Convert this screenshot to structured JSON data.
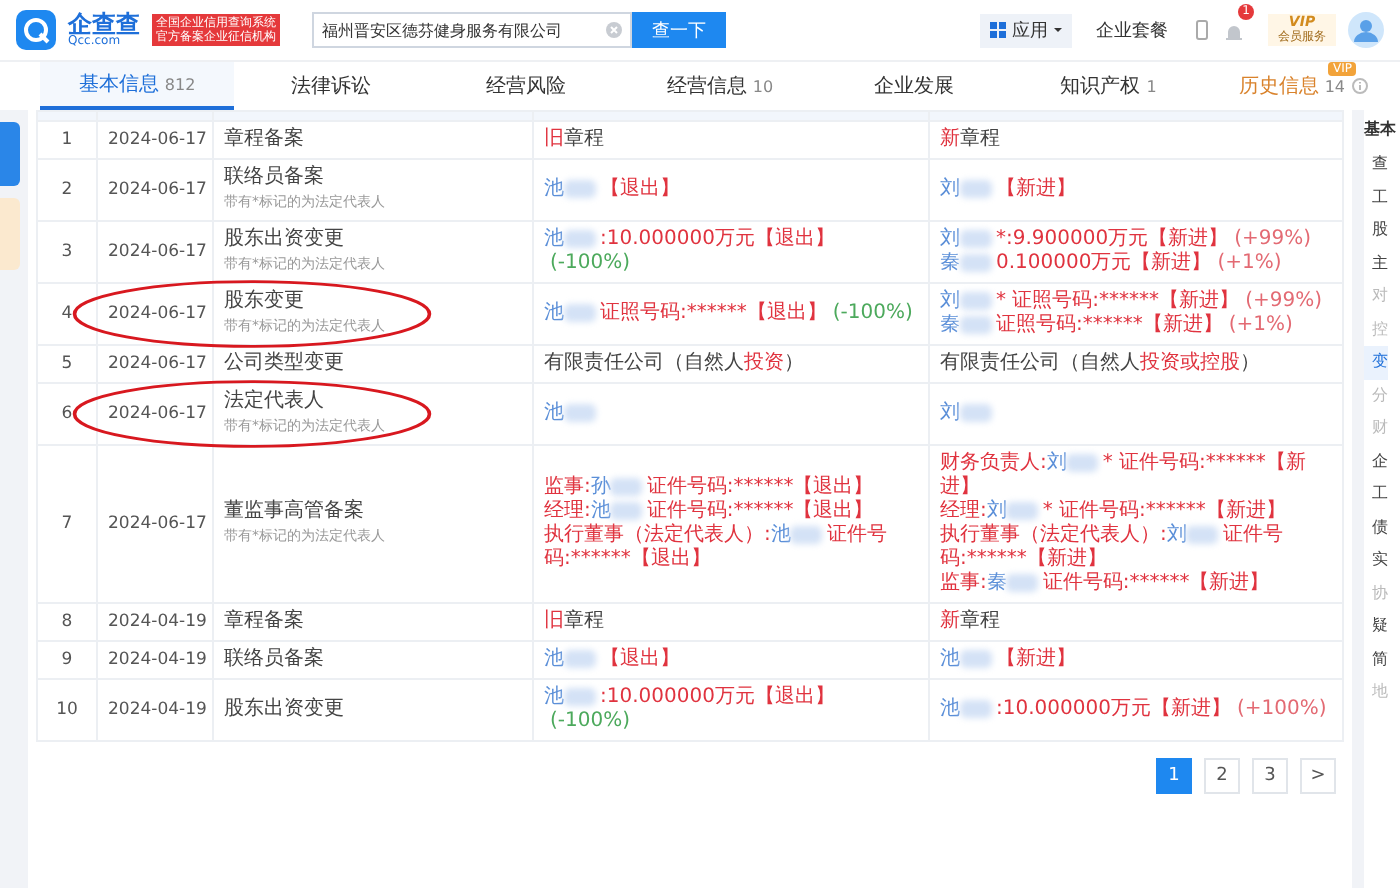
{
  "header": {
    "logo": {
      "name": "企查查",
      "domain": "Qcc.com",
      "slogan": [
        "全国企业信用查询系统",
        "官方备案企业征信机构"
      ]
    },
    "search": {
      "value": "福州晋安区德芬健身服务有限公司",
      "button": "查一下"
    },
    "apps": "应用",
    "plans": "企业套餐",
    "notifications": "1",
    "vip": {
      "badge": "VIP",
      "label": "会员服务"
    }
  },
  "tabs": [
    {
      "label": "基本信息",
      "count": "812",
      "selected": true,
      "kind": "normal"
    },
    {
      "label": "法律诉讼",
      "selected": false,
      "kind": "normal"
    },
    {
      "label": "经营风险",
      "selected": false,
      "kind": "normal"
    },
    {
      "label": "经营信息",
      "count": "10",
      "selected": false,
      "kind": "normal"
    },
    {
      "label": "企业发展",
      "selected": false,
      "kind": "normal"
    },
    {
      "label": "知识产权",
      "count": "1",
      "selected": false,
      "kind": "normal"
    },
    {
      "label": "历史信息",
      "count": "14",
      "selected": false,
      "kind": "premium",
      "badge": "VIP"
    }
  ],
  "table": {
    "rows": [
      {
        "index": "1",
        "date": "2024-06-17",
        "type": "章程备案",
        "circled": false,
        "old": [
          [
            {
              "kind": "red",
              "text": "旧"
            },
            {
              "kind": "plain",
              "text": "章程"
            }
          ]
        ],
        "new": [
          [
            {
              "kind": "red",
              "text": "新"
            },
            {
              "kind": "plain",
              "text": "章程"
            }
          ]
        ]
      },
      {
        "index": "2",
        "date": "2024-06-17",
        "type": "联络员备案",
        "note": "带有*标记的为法定代表人",
        "circled": false,
        "old": [
          [
            {
              "kind": "name",
              "text": "池"
            },
            {
              "kind": "red",
              "text": "【退出】"
            }
          ]
        ],
        "new": [
          [
            {
              "kind": "name",
              "text": "刘"
            },
            {
              "kind": "red",
              "text": "【新进】"
            }
          ]
        ]
      },
      {
        "index": "3",
        "date": "2024-06-17",
        "type": "股东出资变更",
        "note": "带有*标记的为法定代表人",
        "circled": false,
        "old": [
          [
            {
              "kind": "name",
              "text": "池"
            },
            {
              "kind": "red",
              "text": ":10.000000万元【退出】"
            },
            {
              "kind": "down",
              "text": "(-100%)"
            }
          ]
        ],
        "new": [
          [
            {
              "kind": "name",
              "text": "刘"
            },
            {
              "kind": "red",
              "text": "*:9.900000万元【新进】"
            },
            {
              "kind": "up",
              "text": "(+99%)"
            }
          ],
          [
            {
              "kind": "name",
              "text": "秦"
            },
            {
              "kind": "red",
              "text": "0.100000万元【新进】"
            },
            {
              "kind": "up",
              "text": "(+1%)"
            }
          ]
        ]
      },
      {
        "index": "4",
        "date": "2024-06-17",
        "type": "股东变更",
        "note": "带有*标记的为法定代表人",
        "circled": true,
        "old": [
          [
            {
              "kind": "name",
              "text": "池"
            },
            {
              "kind": "red",
              "text": "证照号码:******【退出】"
            },
            {
              "kind": "down",
              "text": "(-100%)"
            }
          ]
        ],
        "new": [
          [
            {
              "kind": "name",
              "text": "刘"
            },
            {
              "kind": "red",
              "text": "* 证照号码:******【新进】"
            },
            {
              "kind": "up",
              "text": "(+99%)"
            }
          ],
          [
            {
              "kind": "name",
              "text": "秦"
            },
            {
              "kind": "red",
              "text": "证照号码:******【新进】"
            },
            {
              "kind": "up",
              "text": "(+1%)"
            }
          ]
        ]
      },
      {
        "index": "5",
        "date": "2024-06-17",
        "type": "公司类型变更",
        "circled": false,
        "old": [
          [
            {
              "kind": "plain",
              "text": "有限责任公司（自然人"
            },
            {
              "kind": "red",
              "text": "投资"
            },
            {
              "kind": "plain",
              "text": "）"
            }
          ]
        ],
        "new": [
          [
            {
              "kind": "plain",
              "text": "有限责任公司（自然人"
            },
            {
              "kind": "red",
              "text": "投资或控股"
            },
            {
              "kind": "plain",
              "text": "）"
            }
          ]
        ]
      },
      {
        "index": "6",
        "date": "2024-06-17",
        "type": "法定代表人",
        "note": "带有*标记的为法定代表人",
        "circled": true,
        "old": [
          [
            {
              "kind": "name",
              "text": "池"
            }
          ]
        ],
        "new": [
          [
            {
              "kind": "name",
              "text": "刘"
            }
          ]
        ]
      },
      {
        "index": "7",
        "date": "2024-06-17",
        "type": "董监事高管备案",
        "note": "带有*标记的为法定代表人",
        "circled": false,
        "old": [
          [
            {
              "kind": "red",
              "text": "监事:"
            },
            {
              "kind": "name",
              "text": "孙"
            },
            {
              "kind": "red",
              "text": "证件号码:******【退出】"
            }
          ],
          [
            {
              "kind": "red",
              "text": "经理:"
            },
            {
              "kind": "name",
              "text": "池"
            },
            {
              "kind": "red",
              "text": "证件号码:******【退出】"
            }
          ],
          [
            {
              "kind": "red",
              "text": "执行董事（法定代表人）:"
            },
            {
              "kind": "name",
              "text": "池"
            },
            {
              "kind": "red",
              "text": "证件号码:******【退出】"
            }
          ]
        ],
        "new": [
          [
            {
              "kind": "red",
              "text": "财务负责人:"
            },
            {
              "kind": "name",
              "text": "刘"
            },
            {
              "kind": "red",
              "text": "* 证件号码:******【新进】"
            }
          ],
          [
            {
              "kind": "red",
              "text": "经理:"
            },
            {
              "kind": "name",
              "text": "刘"
            },
            {
              "kind": "red",
              "text": "* 证件号码:******【新进】"
            }
          ],
          [
            {
              "kind": "red",
              "text": "执行董事（法定代表人）:"
            },
            {
              "kind": "name",
              "text": "刘"
            },
            {
              "kind": "red",
              "text": "证件号码:******【新进】"
            }
          ],
          [
            {
              "kind": "red",
              "text": "监事:"
            },
            {
              "kind": "name",
              "text": "秦"
            },
            {
              "kind": "red",
              "text": "证件号码:******【新进】"
            }
          ]
        ]
      },
      {
        "index": "8",
        "date": "2024-04-19",
        "type": "章程备案",
        "circled": false,
        "old": [
          [
            {
              "kind": "red",
              "text": "旧"
            },
            {
              "kind": "plain",
              "text": "章程"
            }
          ]
        ],
        "new": [
          [
            {
              "kind": "red",
              "text": "新"
            },
            {
              "kind": "plain",
              "text": "章程"
            }
          ]
        ]
      },
      {
        "index": "9",
        "date": "2024-04-19",
        "type": "联络员备案",
        "circled": false,
        "old": [
          [
            {
              "kind": "name",
              "text": "池"
            },
            {
              "kind": "red",
              "text": "【退出】"
            }
          ]
        ],
        "new": [
          [
            {
              "kind": "name",
              "text": "池"
            },
            {
              "kind": "red",
              "text": "【新进】"
            }
          ]
        ]
      },
      {
        "index": "10",
        "date": "2024-04-19",
        "type": "股东出资变更",
        "circled": false,
        "old": [
          [
            {
              "kind": "name",
              "text": "池"
            },
            {
              "kind": "red",
              "text": ":10.000000万元【退出】"
            },
            {
              "kind": "down",
              "text": "(-100%)"
            }
          ]
        ],
        "new": [
          [
            {
              "kind": "name",
              "text": "池"
            },
            {
              "kind": "red",
              "text": ":10.000000万元【新进】"
            },
            {
              "kind": "up",
              "text": "(+100%)"
            }
          ]
        ]
      }
    ]
  },
  "pagination": {
    "pages": [
      {
        "label": "1",
        "selected": true
      },
      {
        "label": "2",
        "selected": false
      },
      {
        "label": "3",
        "selected": false
      }
    ],
    "next": ">"
  },
  "side_panel": {
    "title": "基本",
    "items": [
      {
        "label": "查",
        "muted": false,
        "selected": false
      },
      {
        "label": "工",
        "muted": false,
        "selected": false
      },
      {
        "label": "股",
        "muted": false,
        "selected": false
      },
      {
        "label": "主",
        "muted": false,
        "selected": false
      },
      {
        "label": "对",
        "muted": true,
        "selected": false
      },
      {
        "label": "控",
        "muted": true,
        "selected": false
      },
      {
        "label": "变",
        "muted": false,
        "selected": true
      },
      {
        "label": "分",
        "muted": true,
        "selected": false
      },
      {
        "label": "财",
        "muted": true,
        "selected": false
      },
      {
        "label": "企",
        "muted": false,
        "selected": false
      },
      {
        "label": "工",
        "muted": false,
        "selected": false
      },
      {
        "label": "债",
        "muted": false,
        "selected": false
      },
      {
        "label": "实",
        "muted": false,
        "selected": false
      },
      {
        "label": "协",
        "muted": true,
        "selected": false
      },
      {
        "label": "疑",
        "muted": false,
        "selected": false
      },
      {
        "label": "简",
        "muted": false,
        "selected": false
      },
      {
        "label": "地",
        "muted": true,
        "selected": false
      }
    ]
  }
}
